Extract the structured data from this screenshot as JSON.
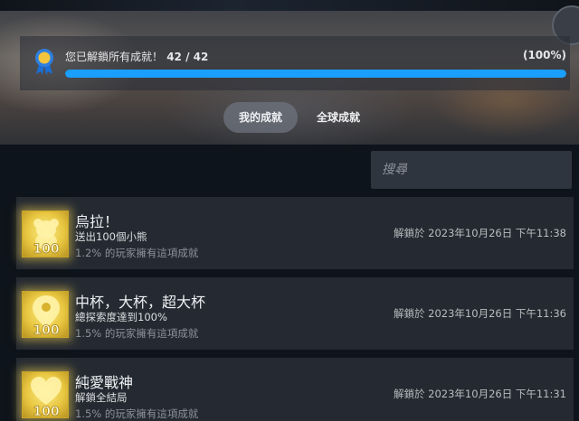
{
  "progress": {
    "label": "您已解鎖所有成就！",
    "count": "42 / 42",
    "percent_text": "(100%)",
    "fraction": 1.0
  },
  "tabs": [
    {
      "label": "我的成就",
      "active": true
    },
    {
      "label": "全球成就",
      "active": false
    }
  ],
  "search": {
    "placeholder": "搜尋"
  },
  "achievements": [
    {
      "title": "烏拉！",
      "description": "送出100個小熊",
      "global_percent": "1.2% 的玩家擁有這項成就",
      "unlocked": "解鎖於 2023年10月26日 下午11:38",
      "icon": "teddy-bear-100-icon"
    },
    {
      "title": "中杯，大杯，超大杯",
      "description": "總探索度達到100%",
      "global_percent": "1.5% 的玩家擁有這項成就",
      "unlocked": "解鎖於 2023年10月26日 下午11:36",
      "icon": "map-pin-100-icon"
    },
    {
      "title": "純愛戰神",
      "description": "解鎖全結局",
      "global_percent": "1.5% 的玩家擁有這項成就",
      "unlocked": "解鎖於 2023年10月26日 下午11:31",
      "icon": "heart-100-icon"
    }
  ],
  "colors": {
    "accent": "#1a9fff",
    "background": "#0e141b",
    "card": "#252a32",
    "gold": "#e9c741"
  }
}
